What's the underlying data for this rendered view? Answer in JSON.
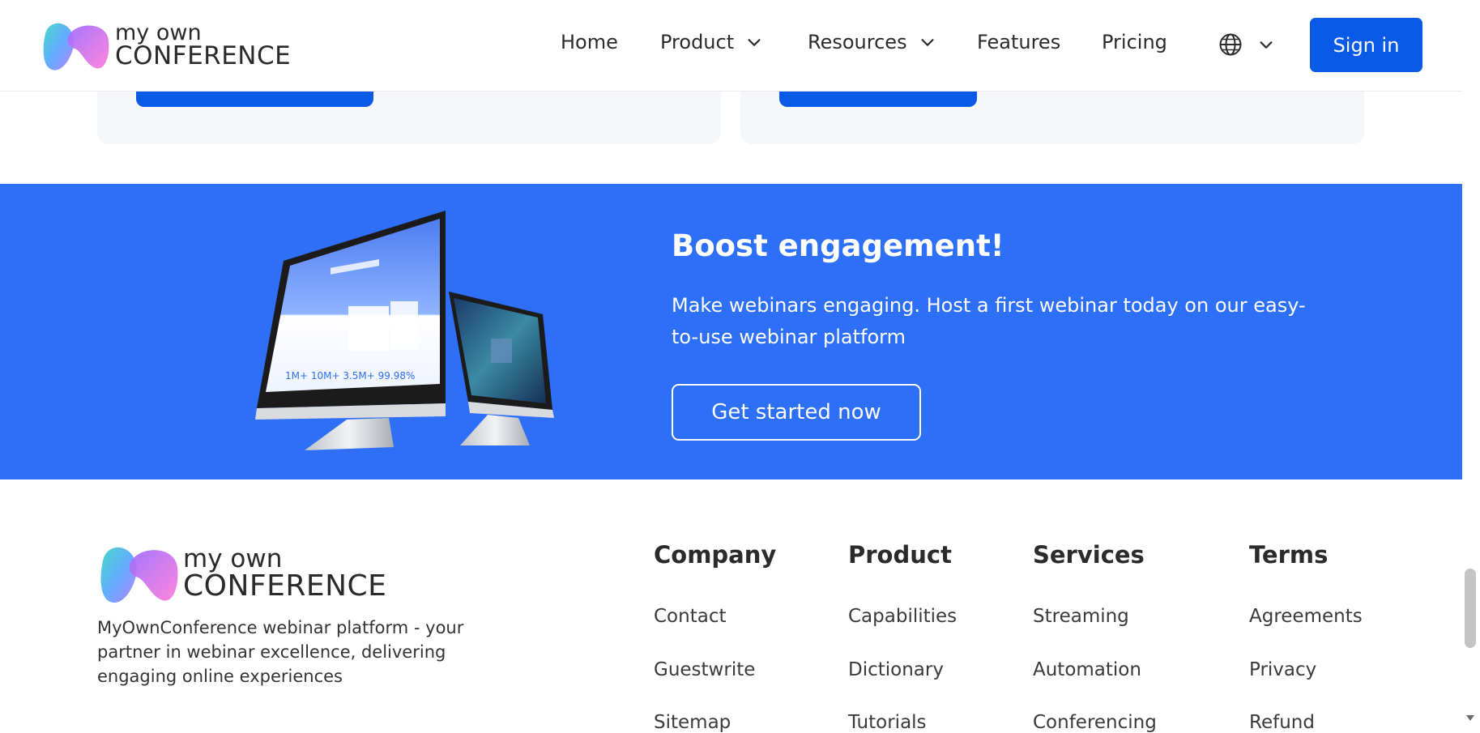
{
  "header": {
    "logo": {
      "line1": "my own",
      "line2": "CONFERENCE"
    },
    "nav": [
      {
        "label": "Home"
      },
      {
        "label": "Product"
      },
      {
        "label": "Resources"
      },
      {
        "label": "Features"
      },
      {
        "label": "Pricing"
      }
    ],
    "language_icon": "globe-icon",
    "sign_in": "Sign in"
  },
  "banner": {
    "title": "Boost engagement!",
    "text": "Make webinars engaging. Host a first webinar today on our easy-to-use webinar platform",
    "cta": "Get started now",
    "image": "monitor-devices-illustration"
  },
  "footer": {
    "logo": {
      "line1": "my own",
      "line2": "CONFERENCE"
    },
    "description": "MyOwnConference webinar platform - your partner in webinar excellence, delivering engaging online experiences",
    "columns": [
      {
        "title": "Company",
        "links": [
          "Contact",
          "Guestwrite",
          "Sitemap"
        ]
      },
      {
        "title": "Product",
        "links": [
          "Capabilities",
          "Dictionary",
          "Tutorials"
        ]
      },
      {
        "title": "Services",
        "links": [
          "Streaming",
          "Automation",
          "Conferencing"
        ]
      },
      {
        "title": "Terms",
        "links": [
          "Agreements",
          "Privacy",
          "Refund"
        ]
      }
    ]
  },
  "colors": {
    "brand_blue": "#0a5ae8",
    "banner_blue": "#2d6ff6",
    "card_bg": "#f6f7f9"
  }
}
